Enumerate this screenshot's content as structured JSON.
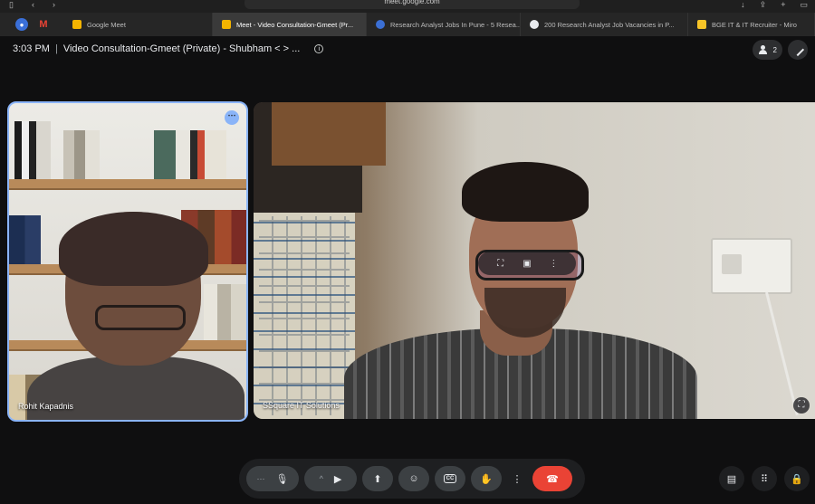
{
  "browser": {
    "url": "meet.google.com",
    "tabs": [
      {
        "label": "Google Meet",
        "color": "#f4b400"
      },
      {
        "label": "Meet - Video Consultation-Gmeet (Pr...",
        "color": "#f4b400",
        "active": true
      },
      {
        "label": "Research Analyst Jobs In Pune - 5 Resea...",
        "color": "#3b6fd4"
      },
      {
        "label": "200 Research Analyst Job Vacancies in P...",
        "color": "#e8eaed"
      },
      {
        "label": "BGE IT & IT Recruiter - Miro",
        "color": "#f7c427"
      }
    ]
  },
  "header": {
    "time": "3:03 PM",
    "separator": "|",
    "meeting_title": "Video Consultation-Gmeet (Private) - Shubham < > ...",
    "participant_count": "2"
  },
  "tiles": {
    "left_name": "Rohit Kapadnis",
    "right_name": "SSquare IT Solutions"
  },
  "icons": {
    "more": "⋯",
    "pin_frame": "⛶",
    "present_frame": "▣",
    "kebab": "⋮",
    "mic": "🎙",
    "chevron": "^",
    "camera": "▶",
    "present": "⬆",
    "emoji": "☺",
    "cc": "CC",
    "hand": "✋",
    "end_call": "☎",
    "chat": "▤",
    "activities": "⠿",
    "host": "🔒"
  },
  "colors": {
    "active_speaker_border": "#8ab4f8",
    "end_call": "#ea4335",
    "control_bg": "#3c4043"
  }
}
